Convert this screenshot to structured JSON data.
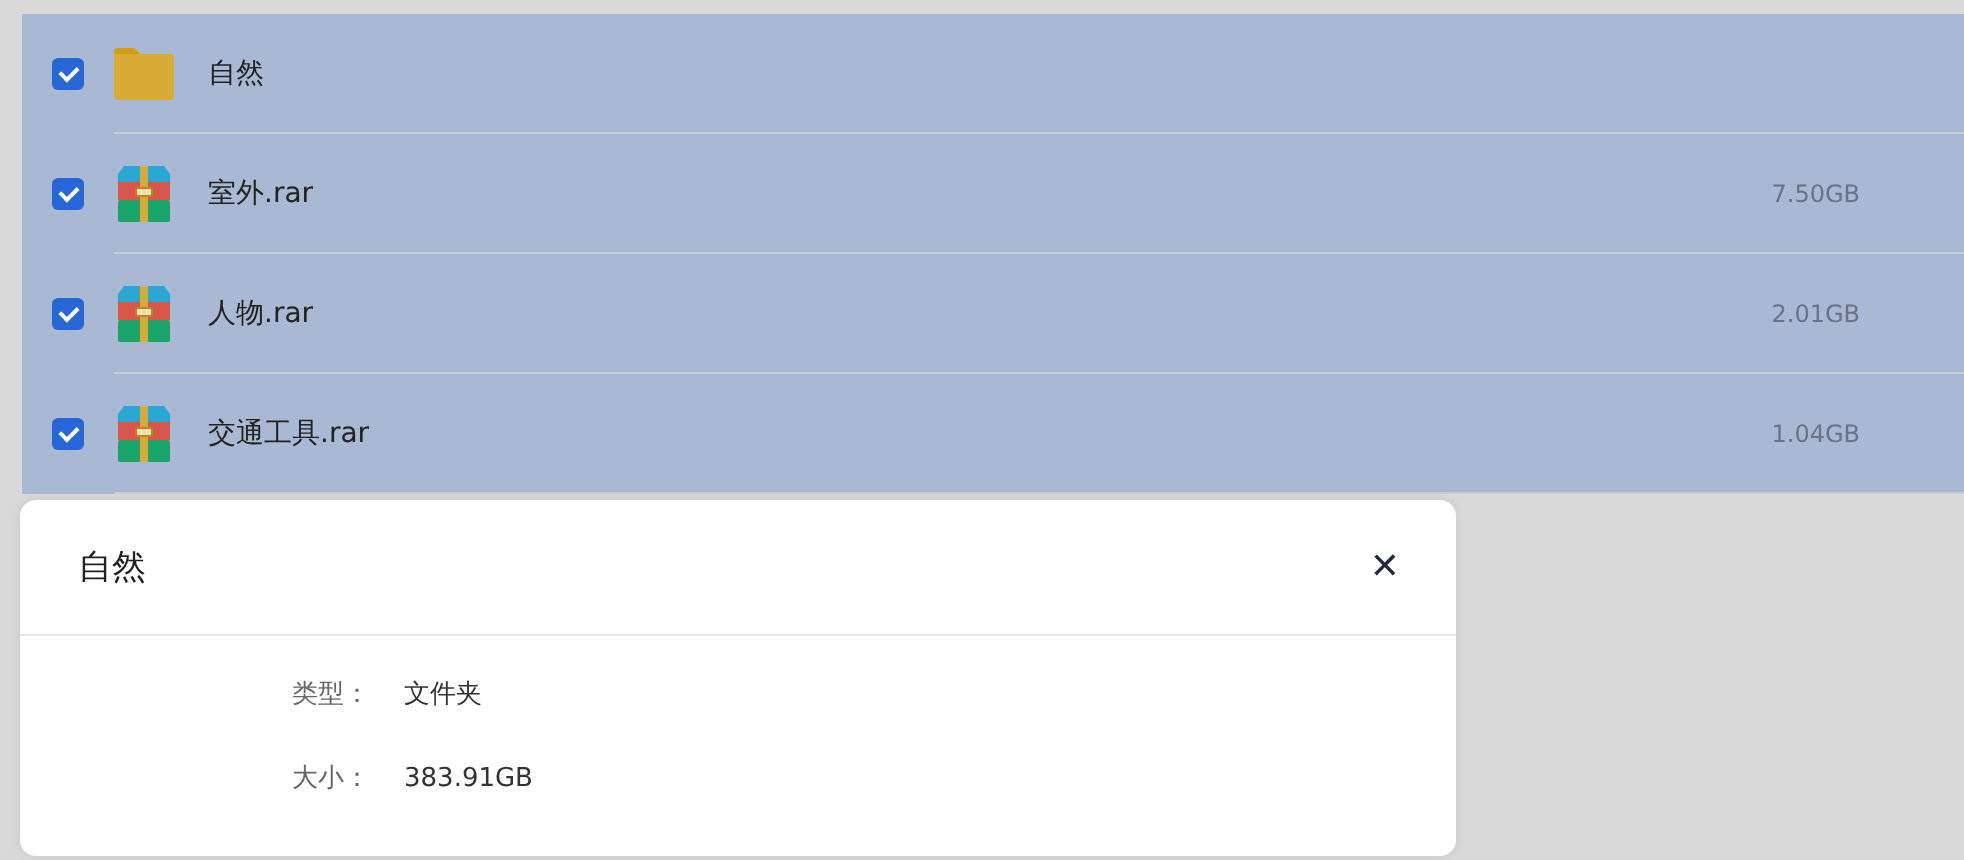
{
  "files": [
    {
      "name": "自然",
      "kind": "folder",
      "checked": true
    },
    {
      "name": "室外.rar",
      "kind": "archive",
      "size": "7.50GB",
      "checked": true
    },
    {
      "name": "人物.rar",
      "kind": "archive",
      "size": "2.01GB",
      "checked": true
    },
    {
      "name": "交通工具.rar",
      "kind": "archive",
      "size": "1.04GB",
      "checked": true
    }
  ],
  "dialog": {
    "title": "自然",
    "close": "✕",
    "fields": [
      {
        "label": "类型：",
        "value": "文件夹"
      },
      {
        "label": "大小：",
        "value": "383.91GB"
      }
    ]
  }
}
